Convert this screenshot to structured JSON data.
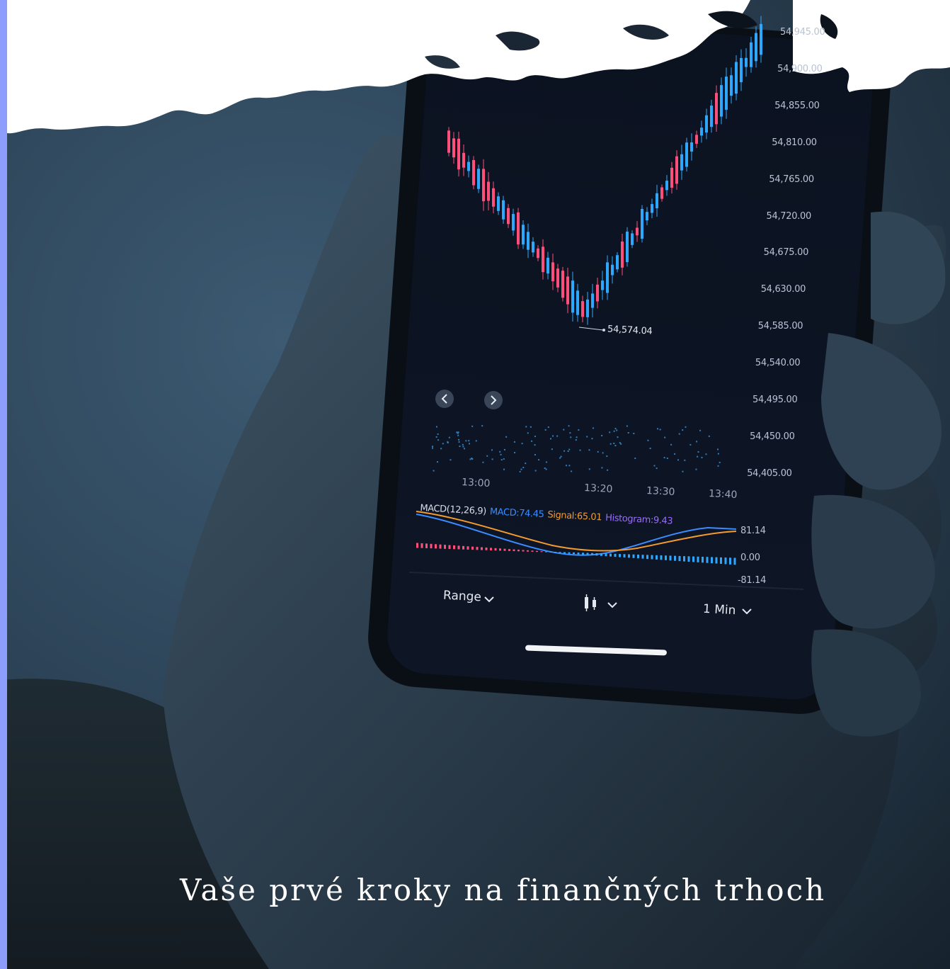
{
  "caption": "Vaše prvé kroky na finančných trhoch",
  "phone": {
    "price_axis": [
      "54,945.00",
      "54,900.00",
      "54,855.00",
      "54,810.00",
      "54,765.00",
      "54,720.00",
      "54,675.00",
      "54,630.00",
      "54,585.00",
      "54,540.00",
      "54,495.00",
      "54,450.00",
      "54,405.00"
    ],
    "low_marker": "54,574.04",
    "time_axis": [
      "13:00",
      "13:20",
      "13:30",
      "13:40"
    ],
    "macd": {
      "params": "MACD(12,26,9)",
      "macd": "MACD:74.45",
      "signal": "Signal:65.01",
      "histogram": "Histogram:9.43",
      "scale": [
        "81.14",
        "0.00",
        "-81.14"
      ]
    },
    "toolbar": {
      "range_label": "Range",
      "chart_type_icon": "candlestick-icon",
      "interval_label": "1 Min"
    },
    "nav_icons": [
      "chevron-left-icon",
      "chevron-right-icon"
    ]
  },
  "colors": {
    "accent_strip": "#8c9dfc",
    "up_candle": "#2ea8ff",
    "down_candle": "#ff4f7a",
    "macd_line": "#3a8cff",
    "signal_line": "#f59a2e",
    "histogram_text": "#9a6bff"
  }
}
